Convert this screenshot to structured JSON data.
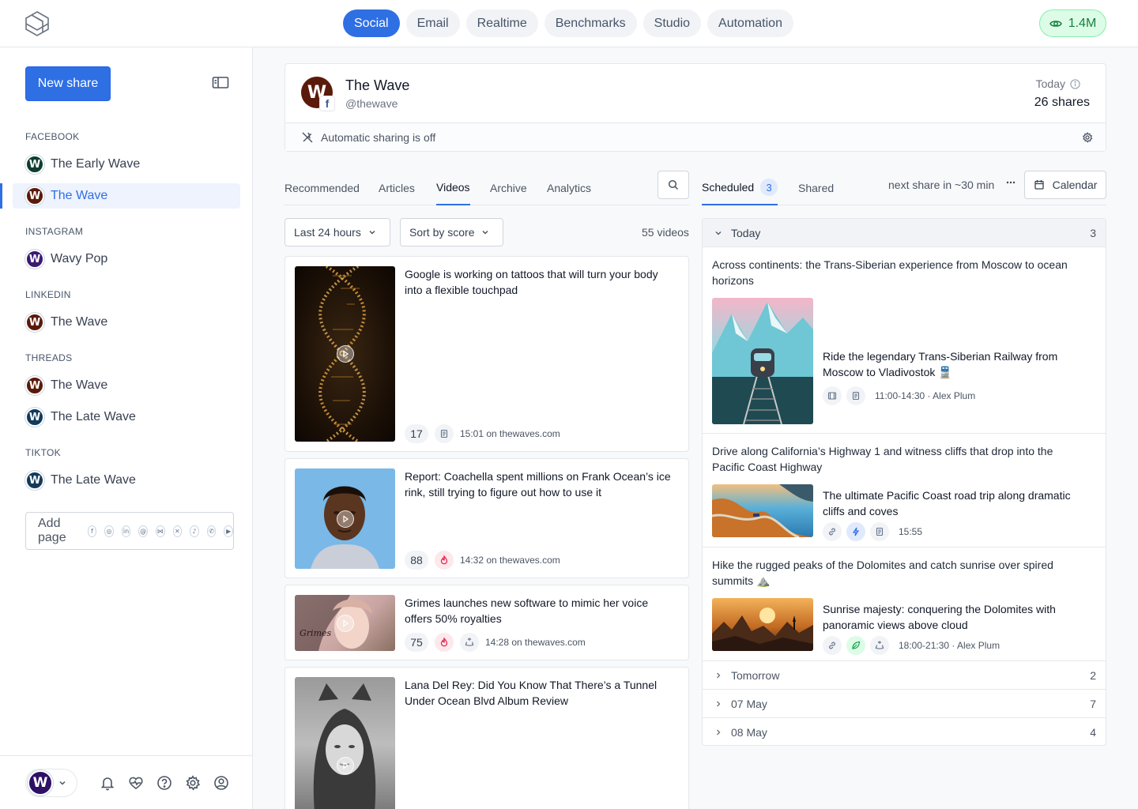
{
  "nav": {
    "tabs": [
      {
        "label": "Social",
        "active": true
      },
      {
        "label": "Email"
      },
      {
        "label": "Realtime"
      },
      {
        "label": "Benchmarks"
      },
      {
        "label": "Studio"
      },
      {
        "label": "Automation"
      }
    ],
    "views": "1.4M"
  },
  "sidebar": {
    "new_share": "New share",
    "sections": [
      {
        "label": "FACEBOOK",
        "items": [
          {
            "label": "The Early Wave"
          },
          {
            "label": "The Wave",
            "active": true
          }
        ]
      },
      {
        "label": "INSTAGRAM",
        "items": [
          {
            "label": "Wavy Pop"
          }
        ]
      },
      {
        "label": "LINKEDIN",
        "items": [
          {
            "label": "The Wave"
          }
        ]
      },
      {
        "label": "THREADS",
        "items": [
          {
            "label": "The Wave"
          },
          {
            "label": "The Late Wave"
          }
        ]
      },
      {
        "label": "TIKTOK",
        "items": [
          {
            "label": "The Late Wave"
          }
        ]
      }
    ],
    "add_page": "Add page"
  },
  "account": {
    "name": "The Wave",
    "handle": "@thewave",
    "today_label": "Today",
    "shares": "26 shares",
    "auto_sharing": "Automatic sharing is off"
  },
  "content_tabs": [
    {
      "label": "Recommended"
    },
    {
      "label": "Articles"
    },
    {
      "label": "Videos",
      "active": true
    },
    {
      "label": "Archive"
    },
    {
      "label": "Analytics"
    }
  ],
  "filters": {
    "time": "Last 24 hours",
    "sort": "Sort by score",
    "count": "55 videos"
  },
  "videos": [
    {
      "title": "Google is working on tattoos that will turn your body into a flexible touchpad",
      "score": "17",
      "meta": "15:01 on thewaves.com"
    },
    {
      "title": "Report: Coachella spent millions on Frank Ocean’s ice rink, still trying to figure out how to use it",
      "score": "88",
      "meta": "14:32 on thewaves.com"
    },
    {
      "title": "Grimes launches new software to mimic her voice offers 50% royalties",
      "score": "75",
      "meta": "14:28 on thewaves.com"
    },
    {
      "title": "Lana Del Rey: Did You Know That There’s a Tunnel Under Ocean Blvd Album Review"
    }
  ],
  "schedule_tabs": {
    "scheduled": "Scheduled",
    "scheduled_count": "3",
    "shared": "Shared",
    "next_share": "next share in ~30 min",
    "calendar": "Calendar"
  },
  "schedule": {
    "today_label": "Today",
    "today_count": "3",
    "items": [
      {
        "desc": "Across continents: the Trans-Siberian experience from Moscow to ocean horizons",
        "title": "Ride the legendary Trans-Siberian Railway from Moscow to Vladivostok 🚆",
        "meta": "11:00-14:30 · Alex Plum"
      },
      {
        "desc": "Drive along California’s Highway 1 and witness cliffs that drop into the Pacific Coast Highway",
        "title": "The ultimate Pacific Coast road trip along dramatic cliffs and coves",
        "meta": "15:55"
      },
      {
        "desc": "Hike the rugged peaks of the Dolomites and catch sunrise over spired summits ⛰️",
        "title": "Sunrise majesty: conquering the Dolomites with panoramic views above cloud",
        "meta": "18:00-21:30 · Alex Plum"
      }
    ],
    "groups": [
      {
        "label": "Tomorrow",
        "count": "2"
      },
      {
        "label": "07 May",
        "count": "7"
      },
      {
        "label": "08 May",
        "count": "4"
      }
    ]
  }
}
